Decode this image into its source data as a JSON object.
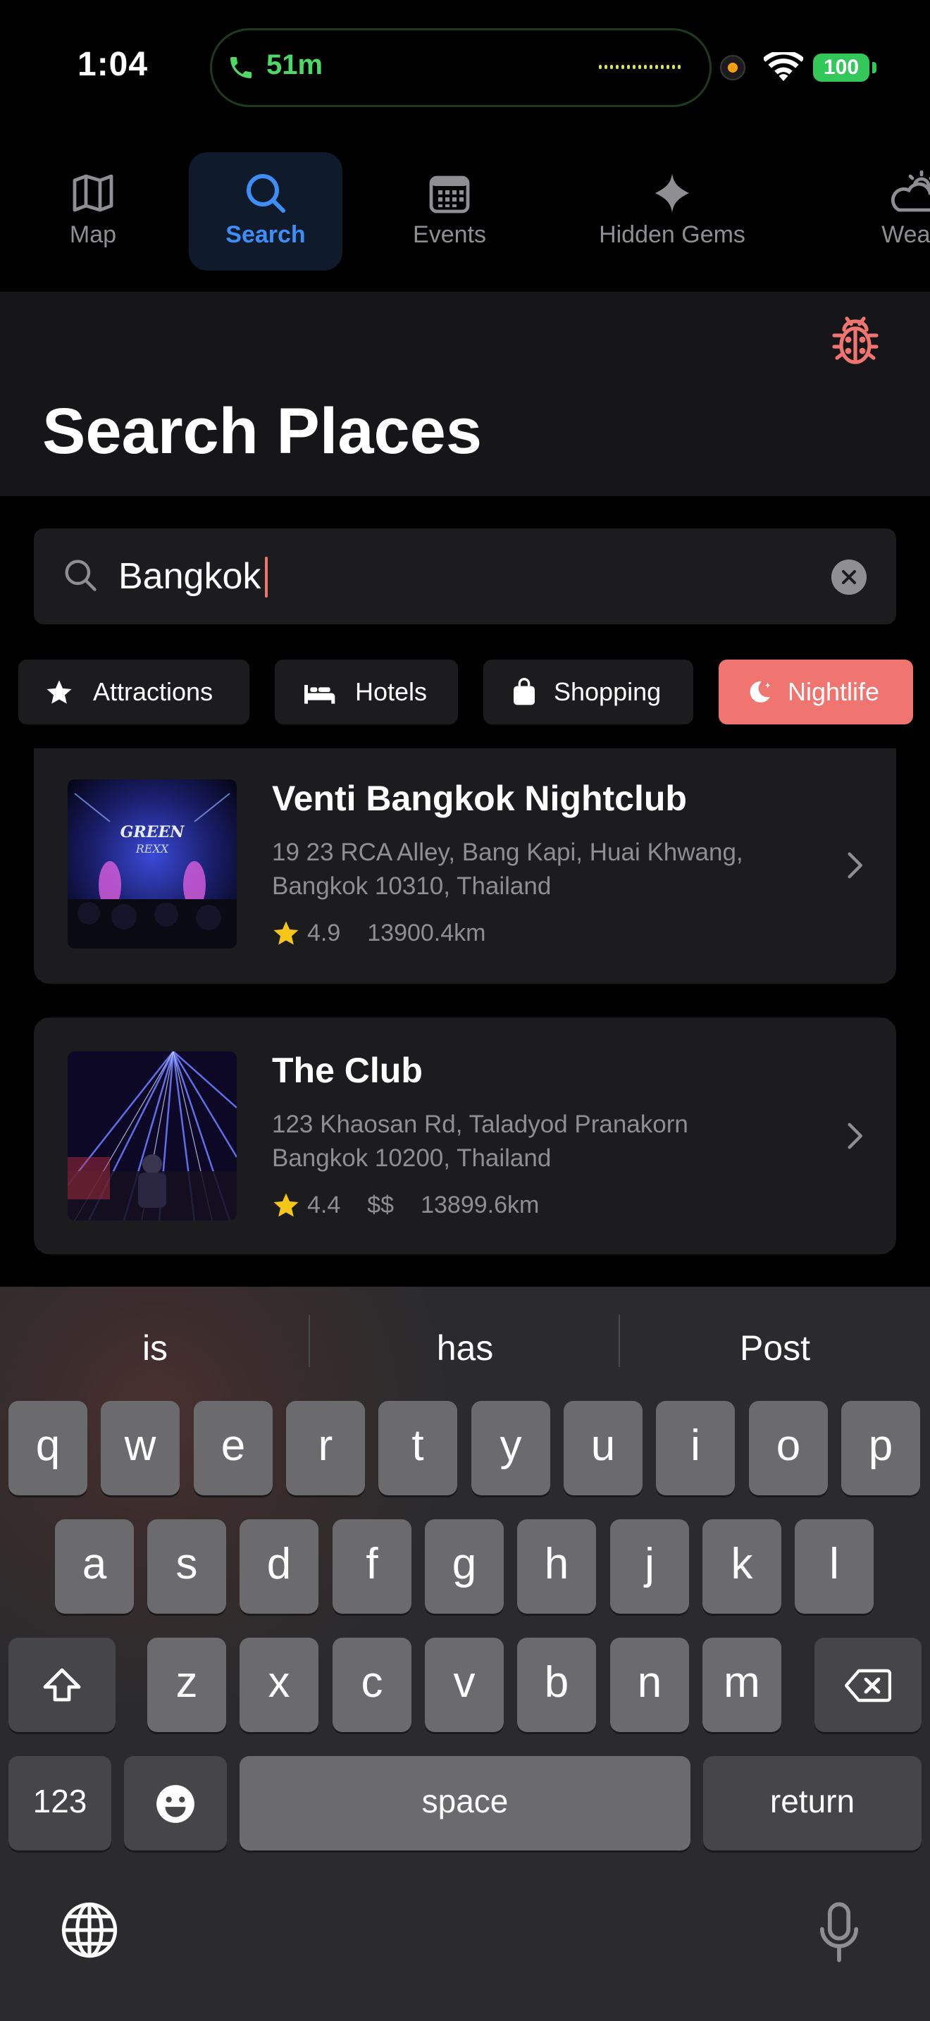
{
  "status_bar": {
    "time": "1:04",
    "call_duration": "51m",
    "battery": "100",
    "accent_green": "#4cd964"
  },
  "tabs": [
    {
      "label": "Map",
      "icon": "map-icon",
      "active": false
    },
    {
      "label": "Search",
      "icon": "search-icon",
      "active": true
    },
    {
      "label": "Events",
      "icon": "calendar-icon",
      "active": false
    },
    {
      "label": "Hidden Gems",
      "icon": "sparkle-icon",
      "active": false
    },
    {
      "label": "Weath",
      "icon": "weather-icon",
      "active": false
    }
  ],
  "header": {
    "title": "Search Places",
    "debug_icon": "ladybug-icon"
  },
  "search": {
    "value": "Bangkok",
    "clear_icon": "close-icon"
  },
  "categories": [
    {
      "label": "Attractions",
      "icon": "star-icon",
      "selected": false
    },
    {
      "label": "Hotels",
      "icon": "bed-icon",
      "selected": false
    },
    {
      "label": "Shopping",
      "icon": "shopping-bag-icon",
      "selected": false
    },
    {
      "label": "Nightlife",
      "icon": "moon-icon",
      "selected": true
    }
  ],
  "results": [
    {
      "name": "Venti Bangkok Nightclub",
      "address": "19 23 RCA Alley, Bang Kapi, Huai Khwang, Bangkok 10310, Thailand",
      "rating": "4.9",
      "price": "",
      "distance": "13900.4km"
    },
    {
      "name": "The Club",
      "address": "123 Khaosan Rd, Taladyod Pranakorn Bangkok 10200, Thailand",
      "rating": "4.4",
      "price": "$$",
      "distance": "13899.6km"
    }
  ],
  "keyboard": {
    "suggestions": [
      "is",
      "has",
      "Post"
    ],
    "row1": [
      "q",
      "w",
      "e",
      "r",
      "t",
      "y",
      "u",
      "i",
      "o",
      "p"
    ],
    "row2": [
      "a",
      "s",
      "d",
      "f",
      "g",
      "h",
      "j",
      "k",
      "l"
    ],
    "row3": [
      "z",
      "x",
      "c",
      "v",
      "b",
      "n",
      "m"
    ],
    "numbers_label": "123",
    "space_label": "space",
    "return_label": "return"
  },
  "colors": {
    "accent_blue": "#3e8ef7",
    "accent_coral": "#f07470",
    "star_yellow": "#f5c518"
  }
}
